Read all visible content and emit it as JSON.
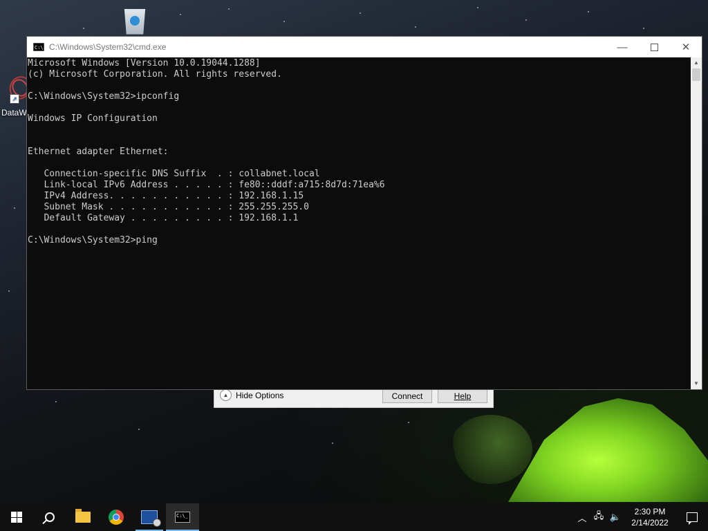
{
  "desktop": {
    "icons": [
      {
        "label": ""
      },
      {
        "label": "DataW"
      }
    ]
  },
  "background_dialog": {
    "hide_options_label": "Hide Options",
    "connect_label": "Connect",
    "help_label": "Help"
  },
  "cmd": {
    "title": "C:\\Windows\\System32\\cmd.exe",
    "lines": [
      "Microsoft Windows [Version 10.0.19044.1288]",
      "(c) Microsoft Corporation. All rights reserved.",
      "",
      "C:\\Windows\\System32>ipconfig",
      "",
      "Windows IP Configuration",
      "",
      "",
      "Ethernet adapter Ethernet:",
      "",
      "   Connection-specific DNS Suffix  . : collabnet.local",
      "   Link-local IPv6 Address . . . . . : fe80::dddf:a715:8d7d:71ea%6",
      "   IPv4 Address. . . . . . . . . . . : 192.168.1.15",
      "   Subnet Mask . . . . . . . . . . . : 255.255.255.0",
      "   Default Gateway . . . . . . . . . : 192.168.1.1",
      "",
      "C:\\Windows\\System32>ping"
    ]
  },
  "taskbar": {
    "clock_time": "2:30 PM",
    "clock_date": "2/14/2022"
  }
}
